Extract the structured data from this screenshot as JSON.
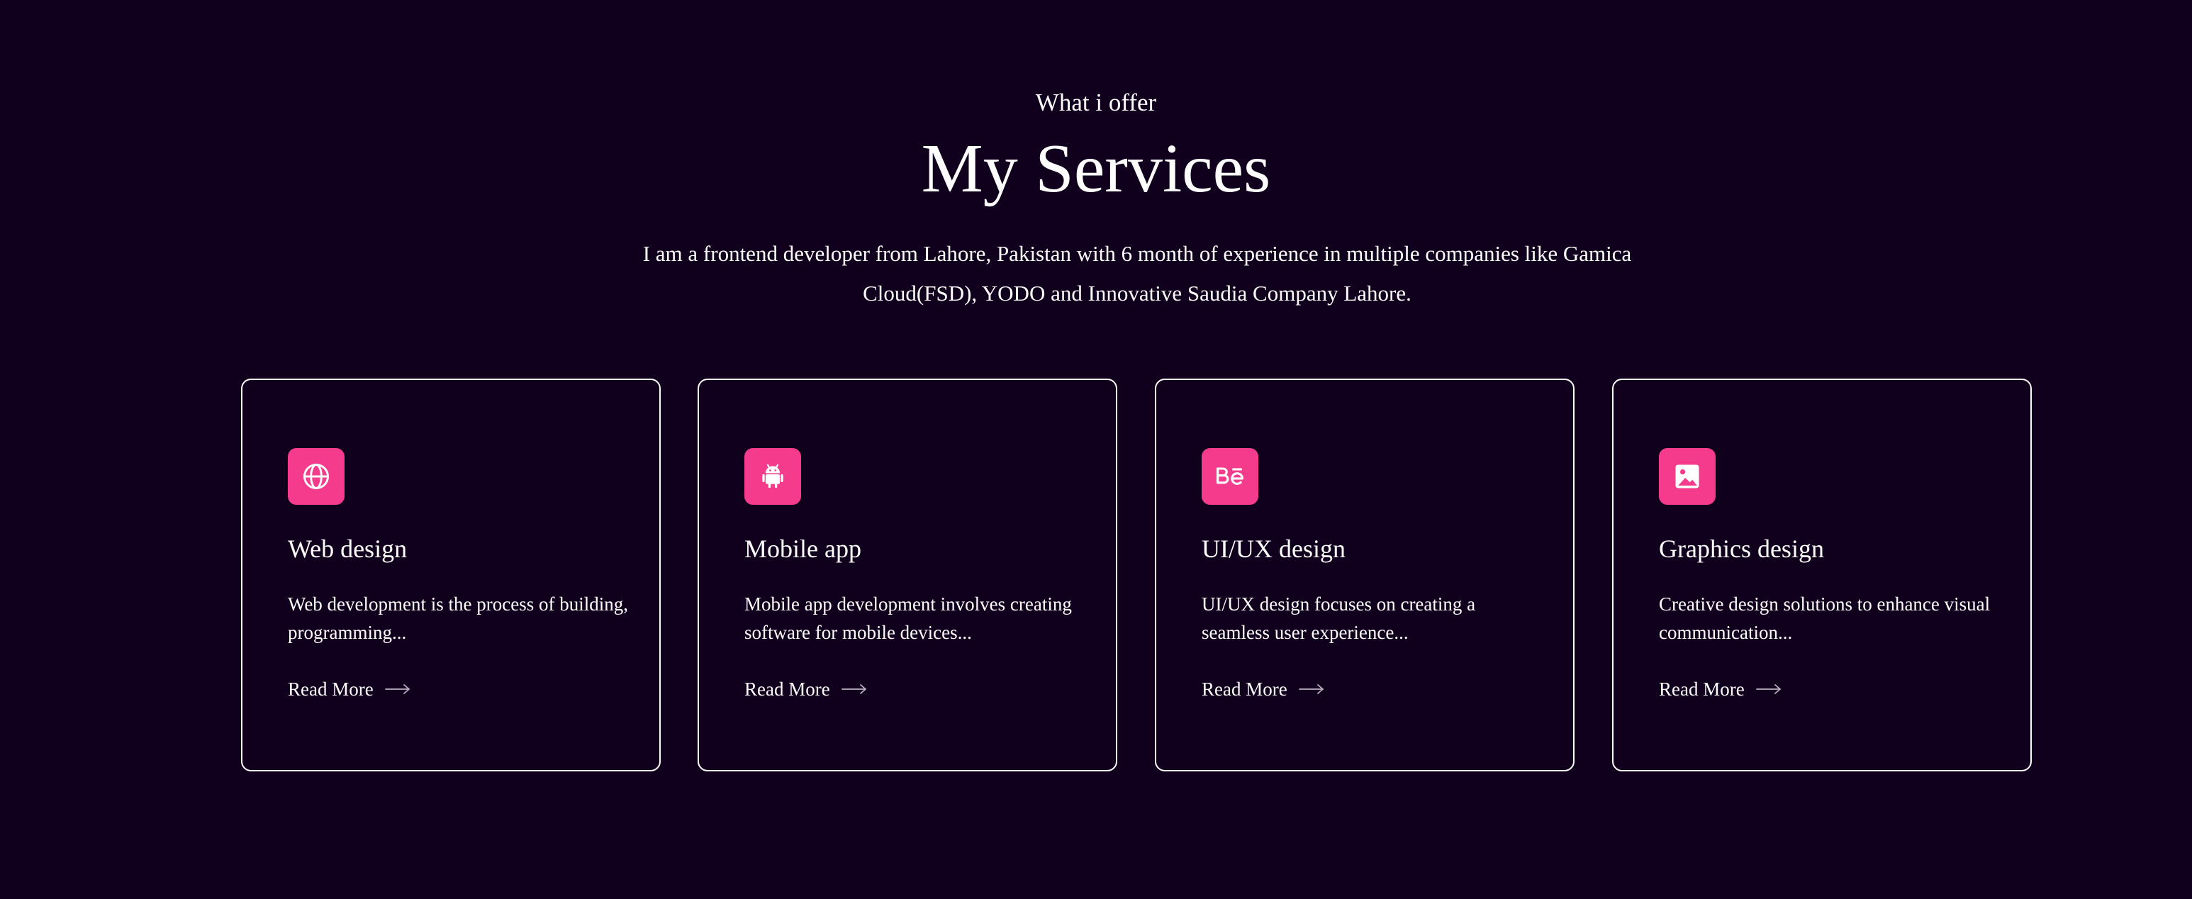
{
  "header": {
    "subtitle": "What i offer",
    "title": "My Services",
    "intro": "I am a frontend developer from Lahore, Pakistan with 6 month of experience in multiple companies like Gamica Cloud(FSD), YODO and Innovative Saudia Company Lahore."
  },
  "colors": {
    "background": "#11001d",
    "accent": "#f53c8c",
    "text": "#ffffff",
    "card_border": "#ffffff"
  },
  "services": [
    {
      "icon": "globe-icon",
      "title": "Web design",
      "description": "Web development is the process of building, programming...",
      "link_label": "Read More"
    },
    {
      "icon": "android-icon",
      "title": "Mobile app",
      "description": "Mobile app development involves creating software for mobile devices...",
      "link_label": "Read More"
    },
    {
      "icon": "behance-icon",
      "title": "UI/UX design",
      "description": "UI/UX design focuses on creating a seamless user experience...",
      "link_label": "Read More"
    },
    {
      "icon": "image-icon",
      "title": "Graphics design",
      "description": "Creative design solutions to enhance visual communication...",
      "link_label": "Read More"
    }
  ]
}
